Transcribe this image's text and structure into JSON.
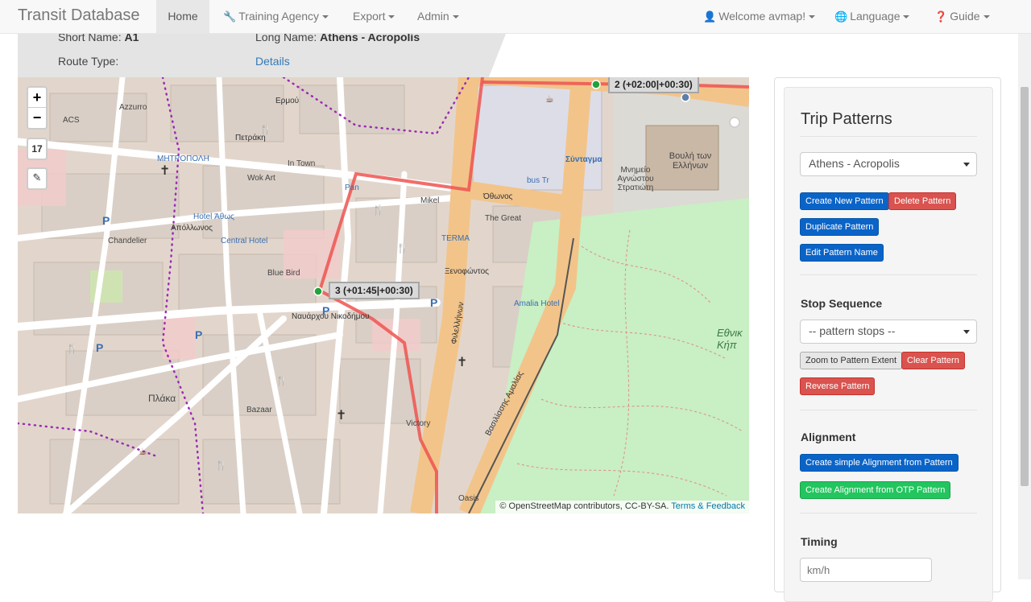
{
  "navbar": {
    "brand": "Transit Database",
    "items": [
      {
        "label": "Home",
        "active": true
      },
      {
        "label": "Training Agency",
        "icon": "wrench-icon"
      },
      {
        "label": "Export"
      },
      {
        "label": "Admin"
      }
    ],
    "right": [
      {
        "label": "Welcome avmap!",
        "icon": "user-icon"
      },
      {
        "label": "Language",
        "icon": "globe-icon"
      },
      {
        "label": "Guide",
        "icon": "question-circle-icon"
      }
    ]
  },
  "route": {
    "short_name_label": "Short Name:",
    "short_name": "A1",
    "long_name_label": "Long Name:",
    "long_name": "Athens - Acropolis",
    "route_type_label": "Route Type:",
    "details_link": "Details"
  },
  "map": {
    "zoom_in": "+",
    "zoom_out": "−",
    "zoom_level": "17",
    "edit_icon": "edit-icon",
    "attribution": "© OpenStreetMap contributors, CC-BY-SA.",
    "attribution_link": "Terms & Feedback",
    "stops": [
      {
        "label": "2 (+02:00|+00:30)"
      },
      {
        "label": "3 (+01:45|+00:30)"
      }
    ],
    "labels": {
      "syntagma": "Σύνταγμα",
      "othonos": "Όθωνος",
      "petraki": "Πετράκη",
      "ermou": "Ερμού",
      "apollonos": "Απόλλωνος",
      "nikodimou": "Ναυάρχου Νικοδήμου",
      "filellinon": "Φιλελλήνων",
      "amalias": "Βασιλίσσης Αμαλίας",
      "xenofontos": "Ξενοφώντος",
      "mitropoli": "ΜΗΤΡΟΠΟΛΗ",
      "plaka": "Πλάκα",
      "vouli": "Βουλή των Ελλήνων",
      "mnimeio": "Μνημείο Αγνώστου Στρατιώτη",
      "ethniko": "Εθνικ Κήπ",
      "hotel_athos": "Hotel Άθως",
      "central_hotel": "Central Hotel",
      "amalia_hotel": "Amalia Hotel",
      "terma": "TERMA",
      "bus_tr": "bus Tr",
      "in_town": "In Town",
      "wok_art": "Wok Art",
      "pan": "Pan",
      "mikel": "Mikel",
      "the_great": "The Great",
      "blue_bird": "Blue Bird",
      "chandelier": "Chandelier",
      "victory": "Victory",
      "oasis": "Oasis",
      "bazaar": "Bazaar",
      "azzurro": "Azzurro",
      "acs": "ACS"
    }
  },
  "panel": {
    "title": "Trip Patterns",
    "pattern_select": "Athens - Acropolis",
    "buttons": {
      "create_new": "Create New Pattern",
      "delete": "Delete Pattern",
      "duplicate": "Duplicate Pattern",
      "edit_name": "Edit Pattern Name",
      "zoom_extent": "Zoom to Pattern Extent",
      "clear": "Clear Pattern",
      "reverse": "Reverse Pattern",
      "simple_alignment": "Create simple Alignment from Pattern",
      "otp_alignment": "Create Alignment from OTP Pattern"
    },
    "stop_sequence_title": "Stop Sequence",
    "stop_select": "-- pattern stops --",
    "alignment_title": "Alignment",
    "timing_title": "Timing",
    "speed_placeholder": "km/h"
  }
}
